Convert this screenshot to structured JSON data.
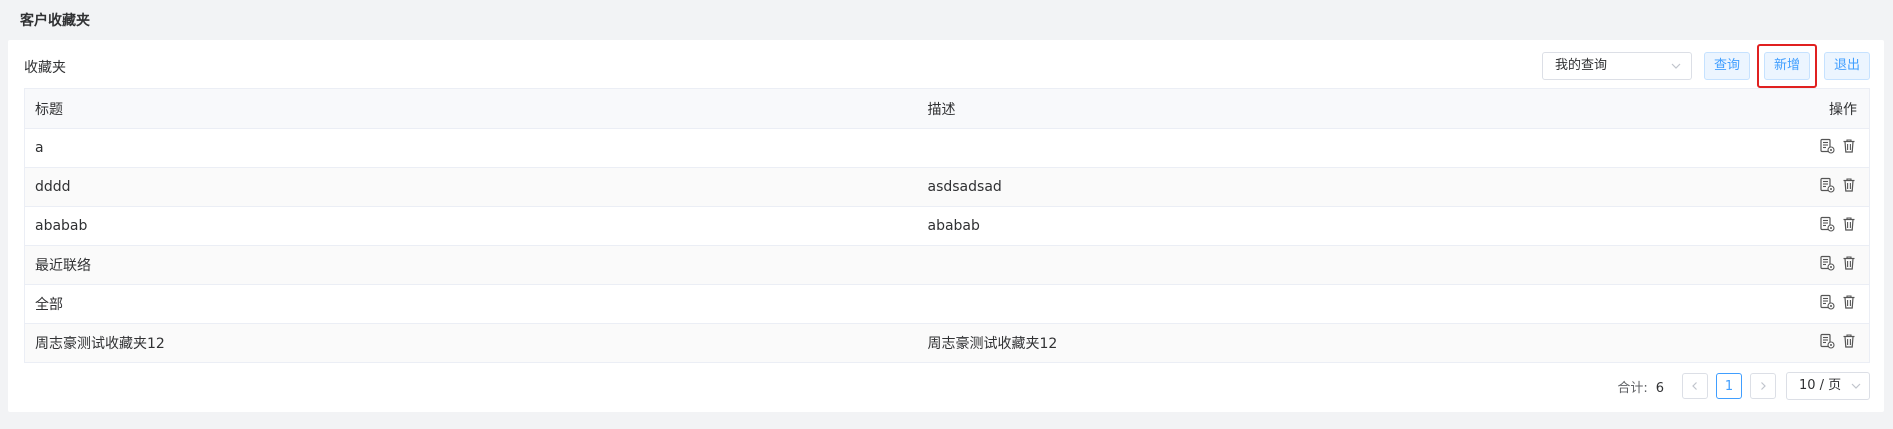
{
  "page": {
    "title": "客户收藏夹"
  },
  "toolbar": {
    "section_label": "收藏夹",
    "select_value": "我的查询",
    "query_label": "查询",
    "add_label": "新增",
    "exit_label": "退出"
  },
  "table": {
    "headers": {
      "title": "标题",
      "desc": "描述",
      "ops": "操作"
    },
    "rows": [
      {
        "title": "a",
        "desc": ""
      },
      {
        "title": "dddd",
        "desc": "asdsadsad"
      },
      {
        "title": "ababab",
        "desc": "ababab"
      },
      {
        "title": "最近联络",
        "desc": ""
      },
      {
        "title": "全部",
        "desc": ""
      },
      {
        "title": "周志豪测试收藏夹12",
        "desc": "周志豪测试收藏夹12"
      }
    ],
    "row_actions": [
      "edit-doc-icon",
      "trash-icon"
    ]
  },
  "pagination": {
    "total_label": "合计:",
    "total": "6",
    "current_page": "1",
    "page_size": "10 / 页"
  },
  "colors": {
    "accent": "#409eff",
    "highlight": "#e02020"
  }
}
